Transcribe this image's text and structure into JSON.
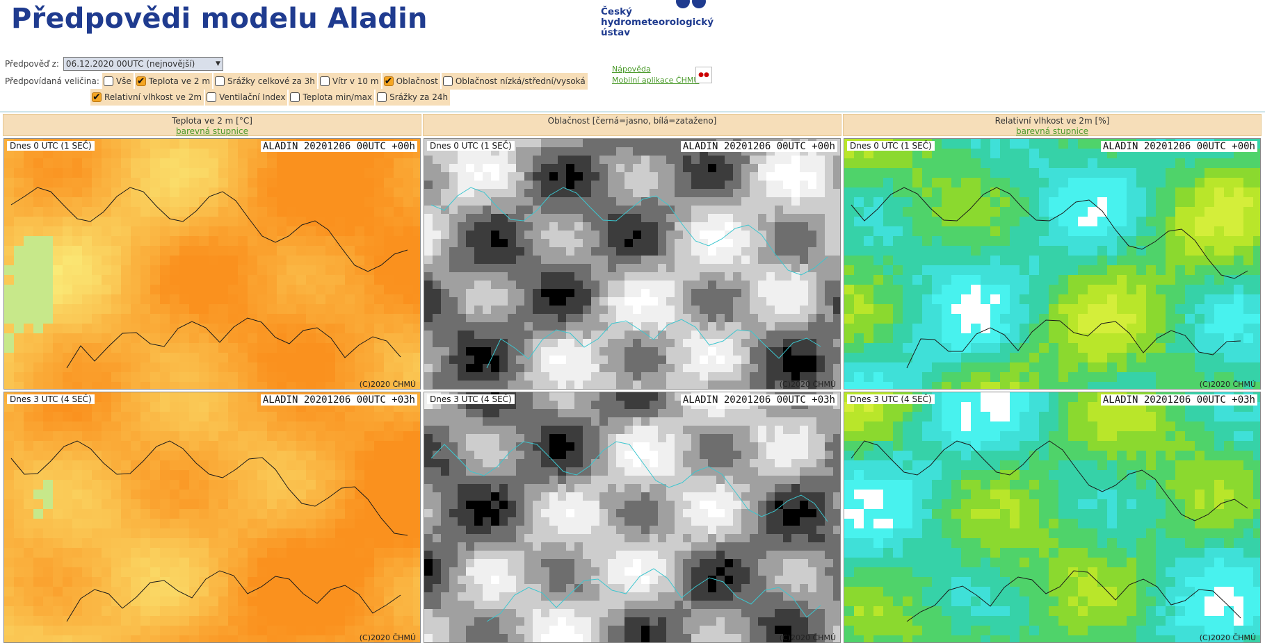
{
  "page": {
    "title": "Předpovědi modelu Aladin"
  },
  "logo": {
    "line1": "Český",
    "line2": "hydrometeorologický",
    "line3": "ústav"
  },
  "forecast": {
    "label": "Předpověď z:",
    "selected": "06.12.2020 00UTC (nejnovější)"
  },
  "variables": {
    "label": "Předpovídaná veličina:",
    "items": [
      {
        "label": "Vše",
        "checked": false
      },
      {
        "label": "Teplota ve 2 m",
        "checked": true
      },
      {
        "label": "Srážky celkové za 3h",
        "checked": false
      },
      {
        "label": "Vítr v 10 m",
        "checked": false
      },
      {
        "label": "Oblačnost",
        "checked": true
      },
      {
        "label": "Oblačnost nízká/střední/vysoká",
        "checked": false
      },
      {
        "label": "Relativní vlhkost ve 2m",
        "checked": true
      },
      {
        "label": "Ventilační Index",
        "checked": false
      },
      {
        "label": "Teplota min/max",
        "checked": false
      },
      {
        "label": "Srážky za 24h",
        "checked": false
      }
    ]
  },
  "links": {
    "help": "Nápověda",
    "mobile": "Mobilní aplikace ČHMÚ"
  },
  "columns": [
    {
      "title": "Teplota ve 2 m [°C]",
      "scale_link": "barevná stupnice"
    },
    {
      "title": "Oblačnost [černá=jasno, bílá=zataženo]",
      "scale_link": ""
    },
    {
      "title": "Relativní vlhkost ve 2m [%]",
      "scale_link": "barevná stupnice"
    }
  ],
  "rows": [
    {
      "time_label": "Dnes 0 UTC (1 SEČ)",
      "run_label": "ALADIN 20201206 00UTC +00h"
    },
    {
      "time_label": "Dnes 3 UTC (4 SEČ)",
      "run_label": "ALADIN 20201206 00UTC +03h"
    }
  ],
  "copyright": "(C)2020 ČHMÚ",
  "colors": {
    "title": "#1f3b8f",
    "header_bg": "#f6deb9",
    "link": "#4a9a2a",
    "checkbox_checked": "#f5a623"
  }
}
